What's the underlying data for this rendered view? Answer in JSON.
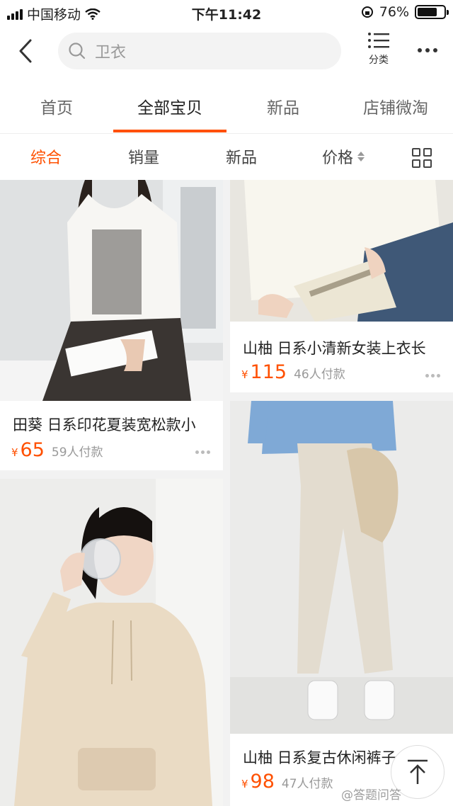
{
  "status_bar": {
    "carrier": "中国移动",
    "time": "下午11:42",
    "battery": "76%",
    "battery_level": 0.76
  },
  "search": {
    "placeholder": "卫衣",
    "category_label": "分类"
  },
  "shop_tabs": [
    {
      "label": "首页",
      "active": false
    },
    {
      "label": "全部宝贝",
      "active": true
    },
    {
      "label": "新品",
      "active": false
    },
    {
      "label": "店铺微淘",
      "active": false
    }
  ],
  "sort": {
    "items": [
      "综合",
      "销量",
      "新品",
      "价格"
    ],
    "active": "综合"
  },
  "products": [
    {
      "title": "田葵 日系印花夏装宽松款小",
      "currency": "¥",
      "price": "65",
      "sales": "59人付款"
    },
    {
      "title": "山柚 日系小清新女装上衣长",
      "currency": "¥",
      "price": "115",
      "sales": "46人付款"
    },
    {
      "title": "",
      "currency": "",
      "price": "",
      "sales": ""
    },
    {
      "title": "山柚 日系复古休闲裤子",
      "currency": "¥",
      "price": "98",
      "sales": "47人付款"
    }
  ],
  "watermark": "@答题问答",
  "colors": {
    "accent": "#ff5000",
    "background": "#f2f2f2"
  },
  "icons": [
    "back-icon",
    "search-icon",
    "category-icon",
    "more-icon",
    "grid-view-icon",
    "back-to-top-icon"
  ]
}
